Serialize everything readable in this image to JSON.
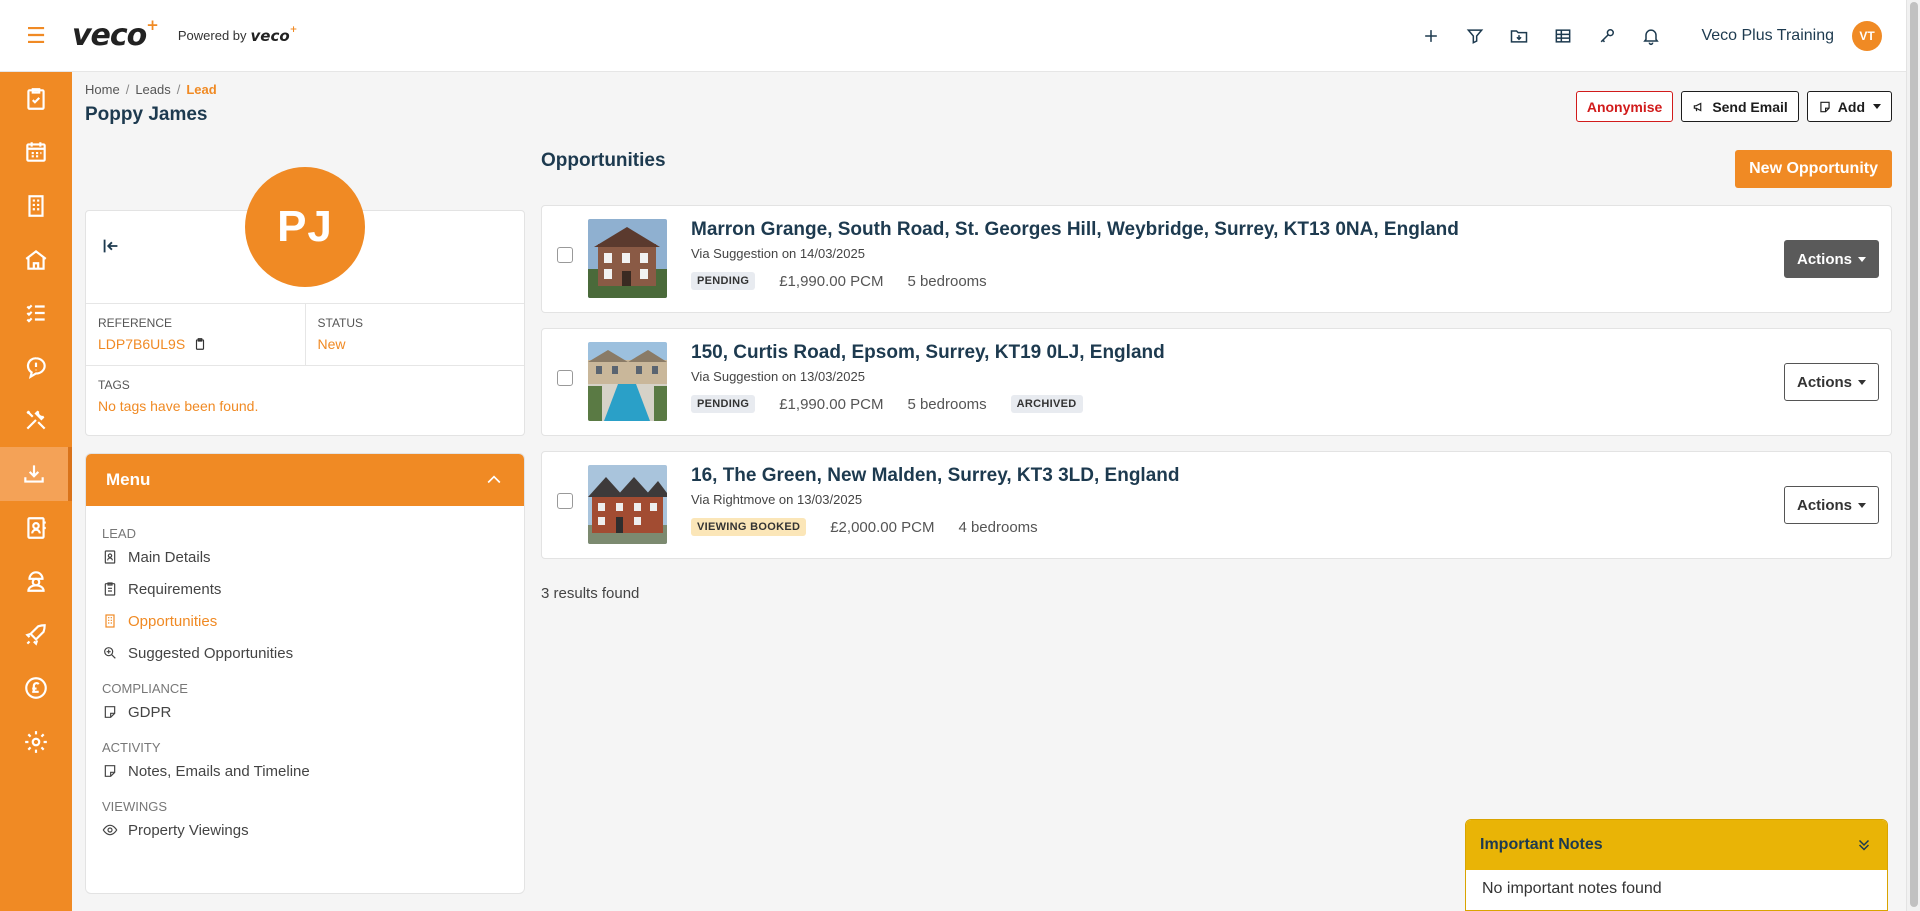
{
  "topbar": {
    "logo": "veco",
    "powered_by": "Powered by",
    "powered_logo": "veco",
    "user_name": "Veco Plus Training",
    "user_initials": "VT"
  },
  "breadcrumb": {
    "home": "Home",
    "leads": "Leads",
    "current": "Lead"
  },
  "page": {
    "title": "Poppy James"
  },
  "header_actions": {
    "anonymise": "Anonymise",
    "send_email": "Send Email",
    "add": "Add"
  },
  "profile": {
    "initials": "PJ",
    "reference_label": "REFERENCE",
    "reference_value": "LDP7B6UL9S",
    "status_label": "STATUS",
    "status_value": "New",
    "tags_label": "TAGS",
    "tags_value": "No tags have been found."
  },
  "menu": {
    "title": "Menu",
    "sections": {
      "lead": "LEAD",
      "compliance": "COMPLIANCE",
      "activity": "ACTIVITY",
      "viewings": "VIEWINGS"
    },
    "items": {
      "main_details": "Main Details",
      "requirements": "Requirements",
      "opportunities": "Opportunities",
      "suggested": "Suggested Opportunities",
      "gdpr": "GDPR",
      "notes": "Notes, Emails and Timeline",
      "property_viewings": "Property Viewings"
    }
  },
  "opportunities": {
    "title": "Opportunities",
    "new_button": "New Opportunity",
    "results": "3 results found",
    "items": [
      {
        "address": "Marron Grange, South Road, St. Georges Hill, Weybridge, Surrey, KT13 0NA, England",
        "via": "Via Suggestion on 14/03/2025",
        "status": "PENDING",
        "price": "£1,990.00 PCM",
        "bedrooms": "5 bedrooms",
        "actions": "Actions"
      },
      {
        "address": "150, Curtis Road, Epsom, Surrey, KT19 0LJ, England",
        "via": "Via Suggestion on 13/03/2025",
        "status": "PENDING",
        "price": "£1,990.00 PCM",
        "bedrooms": "5 bedrooms",
        "extra_badge": "ARCHIVED",
        "actions": "Actions"
      },
      {
        "address": "16, The Green, New Malden, Surrey, KT3 3LD, England",
        "via": "Via Rightmove on 13/03/2025",
        "status": "VIEWING BOOKED",
        "price": "£2,000.00 PCM",
        "bedrooms": "4 bedrooms",
        "actions": "Actions"
      }
    ]
  },
  "important_notes": {
    "title": "Important Notes",
    "body": "No important notes found"
  },
  "colors": {
    "accent": "#f08a24",
    "navy": "#1d3a4f",
    "notes_yellow": "#e9b406"
  }
}
